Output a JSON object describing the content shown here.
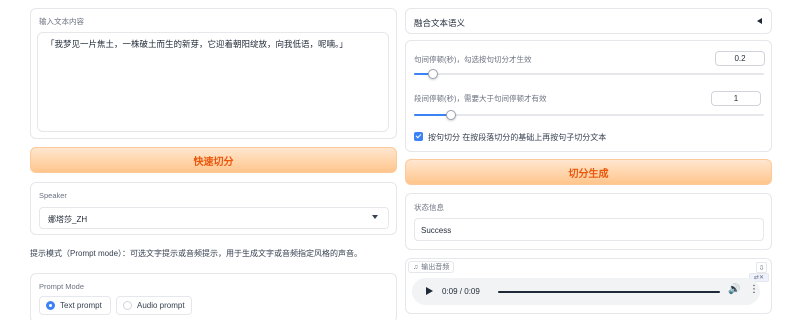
{
  "left": {
    "input": {
      "label": "输入文本内容",
      "value": "「我梦见一片焦土，一株破土而生的新芽，它迎着朝阳绽放，向我低语，呢喃。」"
    },
    "quick_split_button": "快速切分",
    "speaker": {
      "label": "Speaker",
      "value": "娜塔莎_ZH"
    },
    "prompt_hint": "提示模式（Prompt mode）：可选文字提示或音频提示，用于生成文字或音频指定风格的声音。",
    "prompt_mode": {
      "label": "Prompt Mode",
      "options": [
        "Text prompt",
        "Audio prompt"
      ],
      "selected": "Text prompt"
    }
  },
  "right": {
    "accordion_title": "融合文本语义",
    "sentence_pause": {
      "label": "句间停顿(秒)，勾选按句切分才生效",
      "value": "0.2",
      "level": 0.1
    },
    "paragraph_pause": {
      "label": "段间停顿(秒)，需要大于句间停顿才有效",
      "value": "1",
      "level": 0.1
    },
    "split_by_sentence": {
      "label": "按句切分 在按段落切分的基础上再按句子切分文本",
      "checked": true
    },
    "split_generate_button": "切分生成",
    "status": {
      "label": "状态信息",
      "value": "Success"
    },
    "audio": {
      "label": "输出音频",
      "time": "0:09 / 0:09",
      "progress": 1.0
    }
  },
  "colors": {
    "accent": "#3b82f6",
    "button_text": "#ea580c",
    "button_bg": "#ffd3a8"
  }
}
